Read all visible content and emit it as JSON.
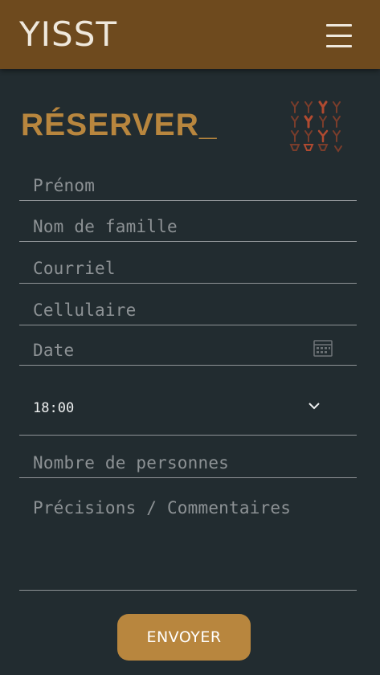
{
  "header": {
    "logo_text": "YISST",
    "menu_icon": "hamburger-menu-icon",
    "background_color": "#6e4a1e"
  },
  "form": {
    "title": "RÉSERVER_",
    "decoration_icon": "glasses-pattern-icon",
    "first_name_placeholder": "Prénom",
    "last_name_placeholder": "Nom de famille",
    "email_placeholder": "Courriel",
    "phone_placeholder": "Cellulaire",
    "date_placeholder": "Date",
    "date_icon": "calendar-icon",
    "time_value": "18:00",
    "time_icon": "chevron-down-icon",
    "guests_placeholder": "Nombre de personnes",
    "comments_placeholder": "Précisions / Commentaires",
    "submit_label": "ENVOYER",
    "accent_color": "#b8863e"
  }
}
